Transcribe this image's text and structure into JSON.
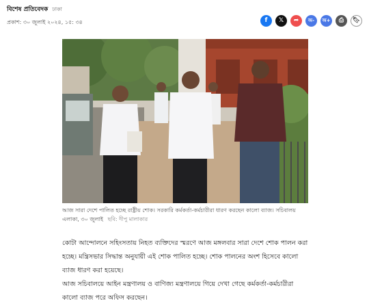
{
  "byline": {
    "author": "বিশেষ প্রতিবেদক",
    "place": "ঢাকা"
  },
  "pubdate": "প্রকাশ: ৩০ জুলাই ২০২৪, ১৫: ৩৪",
  "share": {
    "icons": [
      "facebook-icon",
      "x-twitter-icon",
      "share-icon",
      "font-decrease-icon",
      "font-increase-icon",
      "print-icon",
      "bookmark-icon"
    ],
    "font_small": "অ-",
    "font_large": "অ+"
  },
  "photo": {
    "description_icon": "news-photo"
  },
  "caption": {
    "text": "আজ সারা দেশে পালিত হচ্ছে রাষ্ট্রীয় শোক। সরকারি কর্মকর্তা-কর্মচারীরা ধারণ করছেন কালো ব্যাজ। সচিবালয় এলাকা, ৩০ জুলাই",
    "credit": "ছবি: দীপু মালাকার"
  },
  "paragraphs": [
    "কোটা আন্দোলনে সহিংসতায় নিহত ব্যক্তিদের স্মরণে আজ মঙ্গলবার সারা দেশে শোক পালন করা হচ্ছে। মন্ত্রিসভার সিদ্ধান্ত অনুযায়ী এই শোক পালিত হচ্ছে। শোক পালনের অংশ হিসেবে কালো ব্যাজ ধারণ করা হয়েছে।",
    "আজ সচিবালয়ে আইন মন্ত্রণালয় ও বাণিজ্য মন্ত্রণালয়ে গিয়ে দেখা গেছে কর্মকর্তা-কর্মচারীরা কালো ব্যাজ পরে অফিস করছেন।"
  ],
  "colors": {
    "facebook": "#1877f2",
    "x": "#111111",
    "share": "#ef4e4e",
    "font": "#4a78e6",
    "print": "#555555"
  }
}
